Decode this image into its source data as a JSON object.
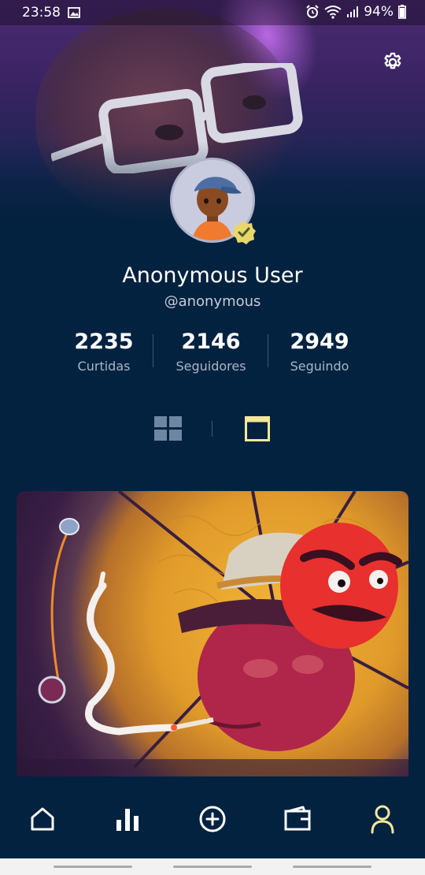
{
  "status_bar": {
    "time": "23:58",
    "battery": "94%"
  },
  "profile": {
    "name": "Anonymous User",
    "handle": "@anonymous",
    "verified": true
  },
  "stats": [
    {
      "value": "2235",
      "label": "Curtidas"
    },
    {
      "value": "2146",
      "label": "Seguidores"
    },
    {
      "value": "2949",
      "label": "Seguindo"
    }
  ],
  "view_modes": {
    "active": "feed",
    "accent_color": "#f3e79b",
    "inactive_color": "#6d86a2"
  },
  "nav": {
    "items": [
      {
        "icon": "home-icon"
      },
      {
        "icon": "stats-icon"
      },
      {
        "icon": "add-icon"
      },
      {
        "icon": "wallet-icon"
      },
      {
        "icon": "profile-icon"
      }
    ],
    "active_color": "#f3e79b",
    "inactive_color": "#ffffff"
  },
  "colors": {
    "background": "#03223f",
    "text_secondary": "#a9b6c6"
  }
}
